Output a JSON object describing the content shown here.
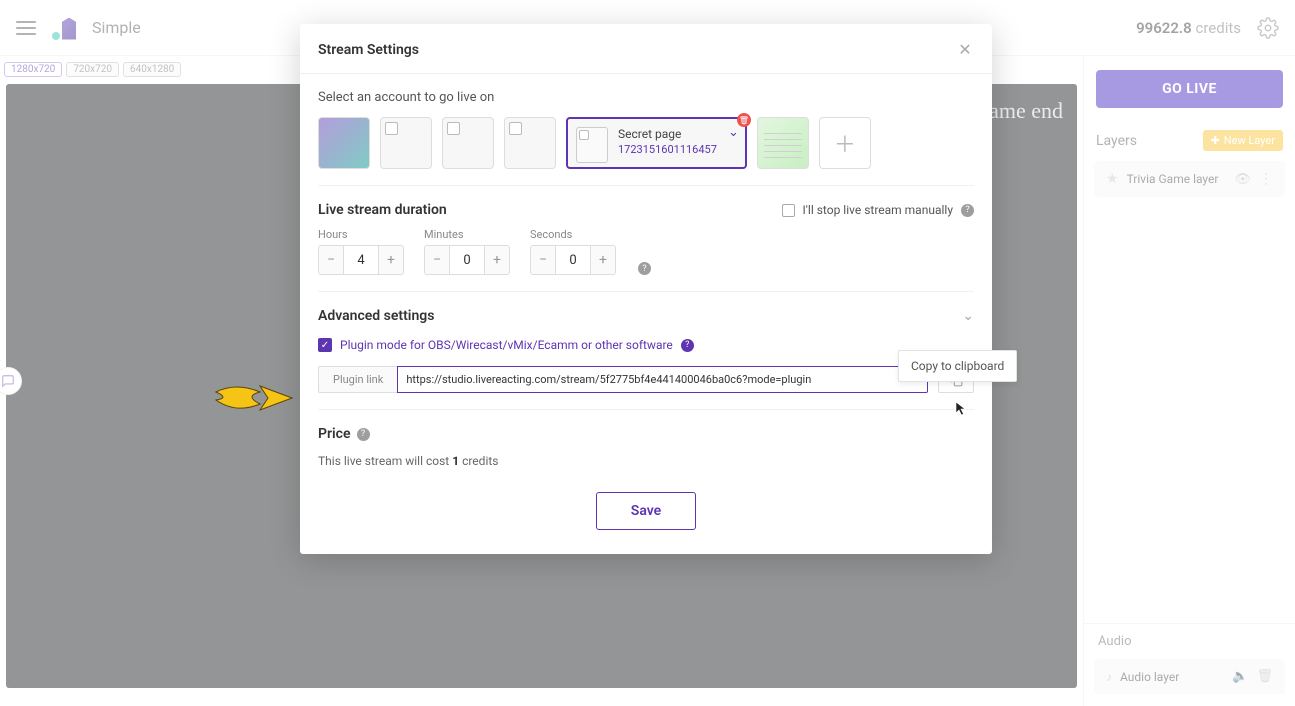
{
  "topbar": {
    "project_name": "Simple",
    "credits_value": "99622.8",
    "credits_label": "credits"
  },
  "resolutions": [
    "1280x720",
    "720x720",
    "640x1280"
  ],
  "stage": {
    "corner_text": "ame end"
  },
  "sidebar": {
    "go_live": "GO LIVE",
    "layers_title": "Layers",
    "new_layer": "New Layer",
    "layers": [
      {
        "name": "Trivia Game layer"
      }
    ],
    "audio_title": "Audio",
    "audio": [
      {
        "name": "Audio layer"
      }
    ]
  },
  "modal": {
    "title": "Stream Settings",
    "accounts": {
      "heading": "Select an account to go live on",
      "selected": {
        "name": "Secret page",
        "id": "1723151601116457"
      }
    },
    "duration": {
      "title": "Live stream duration",
      "manual": "I'll stop live stream manually",
      "labels": {
        "hours": "Hours",
        "minutes": "Minutes",
        "seconds": "Seconds"
      },
      "values": {
        "hours": "4",
        "minutes": "0",
        "seconds": "0"
      }
    },
    "advanced": {
      "title": "Advanced settings",
      "plugin_label": "Plugin mode for OBS/Wirecast/vMix/Ecamm or other software",
      "link_label": "Plugin link",
      "link_value": "https://studio.livereacting.com/stream/5f2775bf4e441400046ba0c6?mode=plugin",
      "copy_tooltip": "Copy to clipboard"
    },
    "price": {
      "title": "Price",
      "text_pre": "This live stream will cost ",
      "value": "1",
      "text_post": " credits"
    },
    "save": "Save"
  }
}
